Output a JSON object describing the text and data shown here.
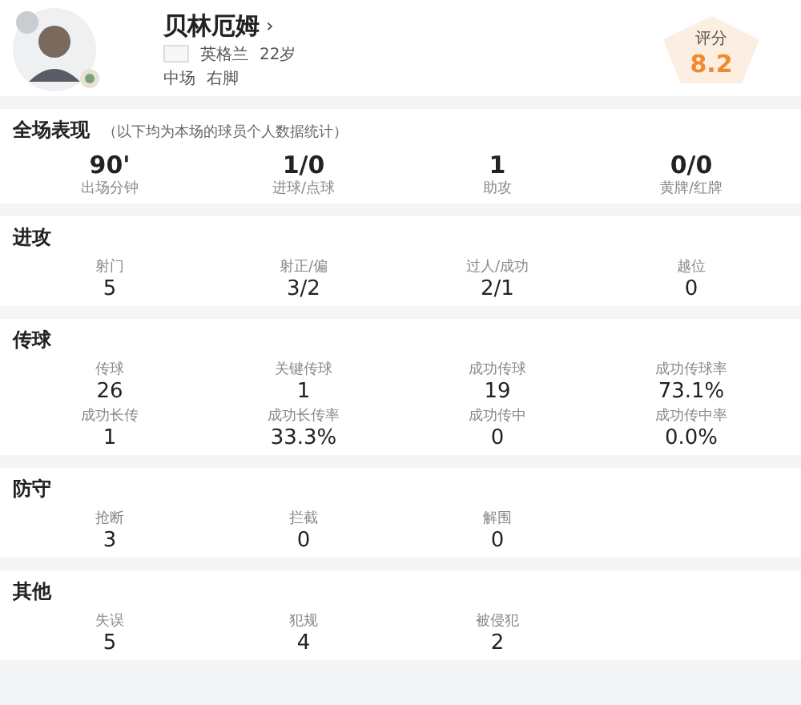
{
  "player": {
    "name": "贝林厄姆",
    "chevron": "›",
    "nationality": "英格兰",
    "age": "22岁",
    "position": "中场",
    "foot": "右脚",
    "rating_label": "评分",
    "rating": "8.2"
  },
  "sections": [
    {
      "kind": "summary",
      "title": "全场表现",
      "note": "（以下均为本场的球员个人数据统计）",
      "stats": [
        {
          "label": "出场分钟",
          "value": "90'"
        },
        {
          "label": "进球/点球",
          "value": "1/0"
        },
        {
          "label": "助攻",
          "value": "1"
        },
        {
          "label": "黄牌/红牌",
          "value": "0/0"
        }
      ]
    },
    {
      "kind": "stats",
      "title": "进攻",
      "stats": [
        {
          "label": "射门",
          "value": "5"
        },
        {
          "label": "射正/偏",
          "value": "3/2"
        },
        {
          "label": "过人/成功",
          "value": "2/1"
        },
        {
          "label": "越位",
          "value": "0"
        }
      ]
    },
    {
      "kind": "stats",
      "title": "传球",
      "stats": [
        {
          "label": "传球",
          "value": "26"
        },
        {
          "label": "关键传球",
          "value": "1"
        },
        {
          "label": "成功传球",
          "value": "19"
        },
        {
          "label": "成功传球率",
          "value": "73.1%"
        },
        {
          "label": "成功长传",
          "value": "1"
        },
        {
          "label": "成功长传率",
          "value": "33.3%"
        },
        {
          "label": "成功传中",
          "value": "0"
        },
        {
          "label": "成功传中率",
          "value": "0.0%"
        }
      ]
    },
    {
      "kind": "stats",
      "title": "防守",
      "stats": [
        {
          "label": "抢断",
          "value": "3"
        },
        {
          "label": "拦截",
          "value": "0"
        },
        {
          "label": "解围",
          "value": "0"
        }
      ]
    },
    {
      "kind": "stats",
      "title": "其他",
      "stats": [
        {
          "label": "失误",
          "value": "5"
        },
        {
          "label": "犯规",
          "value": "4"
        },
        {
          "label": "被侵犯",
          "value": "2"
        }
      ]
    }
  ]
}
